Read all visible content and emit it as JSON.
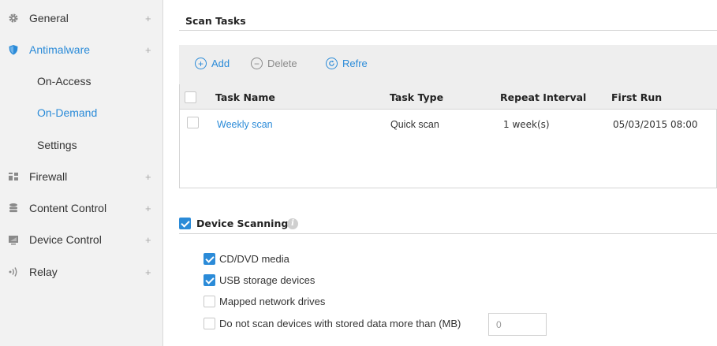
{
  "sidebar": {
    "items": [
      {
        "label": "General",
        "expand": "+"
      },
      {
        "label": "Antimalware",
        "expand": "+"
      },
      {
        "label": "Firewall",
        "expand": "+"
      },
      {
        "label": "Content Control",
        "expand": "+"
      },
      {
        "label": "Device Control",
        "expand": "+"
      },
      {
        "label": "Relay",
        "expand": "+"
      }
    ],
    "antimalware_sub": [
      {
        "label": "On-Access"
      },
      {
        "label": "On-Demand"
      },
      {
        "label": "Settings"
      }
    ]
  },
  "scan_tasks": {
    "title": "Scan Tasks",
    "toolbar": {
      "add": "Add",
      "delete": "Delete",
      "refresh": "Refre"
    },
    "columns": [
      "Task Name",
      "Task Type",
      "Repeat Interval",
      "First Run"
    ],
    "rows": [
      {
        "name": "Weekly scan",
        "type": "Quick scan",
        "interval": "1 week(s)",
        "first_run": "05/03/2015 08:00"
      }
    ]
  },
  "device_scanning": {
    "title": "Device Scanning",
    "enabled": true,
    "options": [
      {
        "label": "CD/DVD media",
        "checked": true
      },
      {
        "label": "USB storage devices",
        "checked": true
      },
      {
        "label": "Mapped network drives",
        "checked": false
      },
      {
        "label": "Do not scan devices with stored data more than (MB)",
        "checked": false
      }
    ],
    "max_size_value": "0"
  },
  "colors": {
    "accent": "#2b8bd8",
    "sidebar_bg": "#f2f2f2",
    "toolbar_bg": "#eeeeee"
  }
}
